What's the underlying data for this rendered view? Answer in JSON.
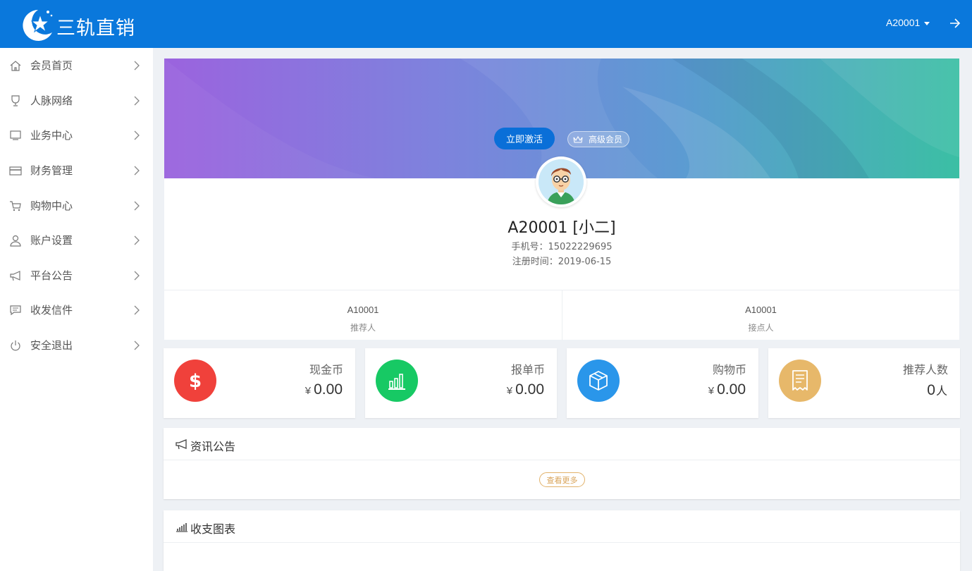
{
  "header": {
    "brand": "三轨直销",
    "username": "A20001",
    "icons": {
      "logo": "star-moon-logo-icon",
      "logout": "arrow-right-icon"
    }
  },
  "sidebar": {
    "items": [
      {
        "label": "会员首页",
        "icon": "home-icon"
      },
      {
        "label": "人脉网络",
        "icon": "trophy-icon"
      },
      {
        "label": "业务中心",
        "icon": "monitor-icon"
      },
      {
        "label": "财务管理",
        "icon": "card-icon"
      },
      {
        "label": "购物中心",
        "icon": "cart-icon"
      },
      {
        "label": "账户设置",
        "icon": "user-icon"
      },
      {
        "label": "平台公告",
        "icon": "megaphone-icon"
      },
      {
        "label": "收发信件",
        "icon": "message-icon"
      },
      {
        "label": "安全退出",
        "icon": "power-icon"
      }
    ]
  },
  "profile": {
    "activate_label": "立即激活",
    "level_label": "高级会员",
    "name": "A20001 [小二]",
    "phone": "手机号：15022229695",
    "register": "注册时间：2019-06-15",
    "referrer": {
      "value": "A10001",
      "label": "推荐人"
    },
    "placement": {
      "value": "A10001",
      "label": "接点人"
    }
  },
  "stats": [
    {
      "title": "现金币",
      "prefix": "¥",
      "value": "0.00",
      "suffix": "",
      "icon": "dollar-icon",
      "color": "#f0413b"
    },
    {
      "title": "报单币",
      "prefix": "¥",
      "value": "0.00",
      "suffix": "",
      "icon": "bar-chart-icon",
      "color": "#17c964"
    },
    {
      "title": "购物币",
      "prefix": "¥",
      "value": "0.00",
      "suffix": "",
      "icon": "box-icon",
      "color": "#2a96ea"
    },
    {
      "title": "推荐人数",
      "prefix": "",
      "value": "0",
      "suffix": "人",
      "icon": "receipt-icon",
      "color": "#e7b86a"
    }
  ],
  "news": {
    "title": "资讯公告",
    "more_label": "查看更多"
  },
  "chart_panel": {
    "title": "收支图表"
  },
  "colors": {
    "primary": "#0a78dc",
    "page_bg": "#eef1f5"
  }
}
